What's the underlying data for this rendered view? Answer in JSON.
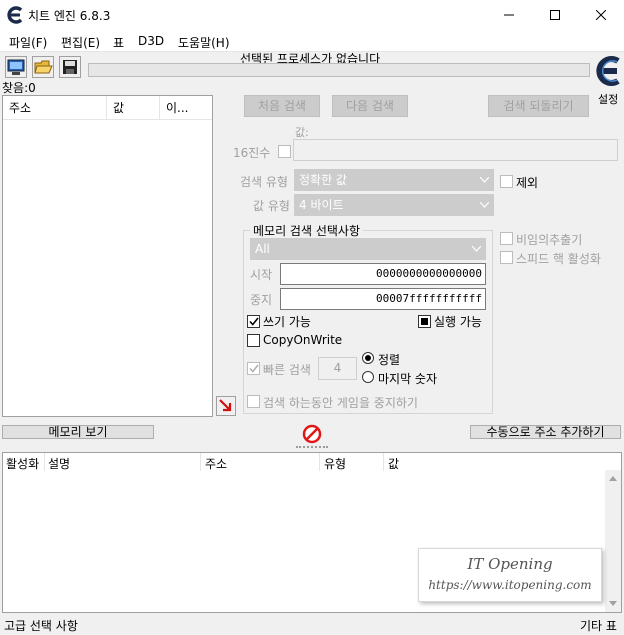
{
  "window": {
    "title": "치트 엔진 6.8.3"
  },
  "menu": [
    "파일(F)",
    "편집(E)",
    "표",
    "D3D",
    "도움말(H)"
  ],
  "process_label": "선택된 프로세스가 없습니다",
  "settings_label": "설정",
  "found_count": "찾음:0",
  "results_table": {
    "columns": [
      "주소",
      "값",
      "이..."
    ]
  },
  "buttons": {
    "first_scan": "처음 검색",
    "next_scan": "다음 검색",
    "undo_scan": "검색 되돌리기",
    "memory_view": "메모리 보기",
    "add_address_manually": "수동으로 주소 추가하기"
  },
  "value": {
    "label": "값:",
    "hex_label": "16진수",
    "value": ""
  },
  "scan_type": {
    "label": "검색 유형",
    "selected": "정확한 값"
  },
  "value_type": {
    "label": "값 유형",
    "selected": "4 바이트"
  },
  "exclude_label": "제외",
  "memory_options": {
    "title": "메모리 검색 선택사항",
    "region": "All",
    "start_label": "시작",
    "start_value": "0000000000000000",
    "stop_label": "중지",
    "stop_value": "00007fffffffffff",
    "writable": "쓰기 가능",
    "executable": "실행 가능",
    "copy_on_write": "CopyOnWrite",
    "fast_scan": "빠른 검색",
    "fast_scan_value": "4",
    "alignment": "정렬",
    "last_digits": "마지막 숫자",
    "pause_game": "검색 하는동안 게임을 중지하기"
  },
  "right_options": {
    "unrandomizer": "비임의추출기",
    "speedhack": "스피드 핵 활성화"
  },
  "address_list": {
    "columns": [
      "활성화",
      "설명",
      "주소",
      "유형",
      "값"
    ]
  },
  "watermark": {
    "line1": "IT Opening",
    "line2": "https://www.itopening.com"
  },
  "statusbar": {
    "left": "고급 선택 사항",
    "right": "기타 표"
  }
}
